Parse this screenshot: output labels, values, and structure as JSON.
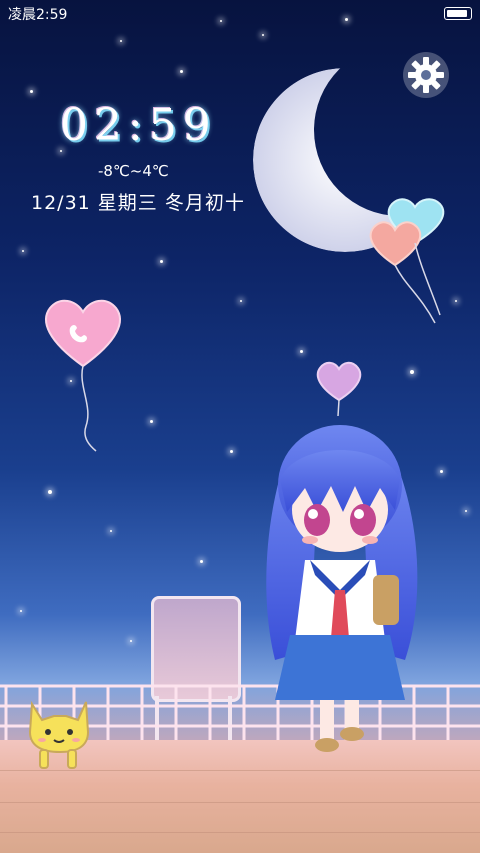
{
  "status_bar": {
    "time": "凌晨2:59",
    "battery_level": 0.9
  },
  "lockscreen": {
    "clock": "02:59",
    "temperature": "-8℃~4℃",
    "date": "12/31 星期三 冬月初十"
  },
  "icons": {
    "settings": "gear-icon",
    "phone": "phone-icon"
  },
  "colors": {
    "sky_top": "#07133f",
    "sky_mid": "#1a3f8e",
    "moon": "#e8e8f4",
    "balloon_pink": "#f7a8cf",
    "balloon_blue": "#9ee3f2",
    "balloon_peach": "#f4a8a0",
    "balloon_purple": "#d7a6e2"
  }
}
